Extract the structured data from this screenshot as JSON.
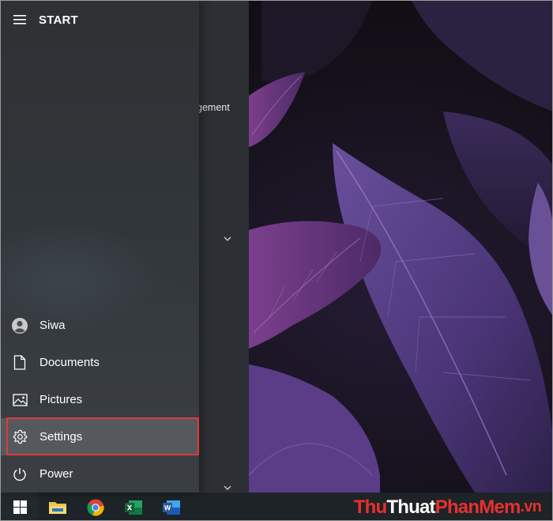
{
  "start_menu": {
    "title": "START",
    "apps_partial_label": "gement",
    "items": [
      {
        "label": "Siwa",
        "icon": "user-avatar-icon"
      },
      {
        "label": "Documents",
        "icon": "document-icon"
      },
      {
        "label": "Pictures",
        "icon": "pictures-icon"
      },
      {
        "label": "Settings",
        "icon": "gear-icon",
        "highlighted": true
      },
      {
        "label": "Power",
        "icon": "power-icon"
      }
    ]
  },
  "taskbar": {
    "apps": [
      "windows-start-icon",
      "file-explorer-icon",
      "chrome-icon",
      "excel-icon",
      "word-icon"
    ]
  },
  "watermark": {
    "part1": "Thu",
    "part2": "Thuat",
    "part3": "PhanMem",
    "part4": ".vn"
  },
  "colors": {
    "highlight_border": "#e0393e",
    "menu_bg": "#2f3236",
    "taskbar_bg": "#1d2326",
    "accent_red": "#e8302f"
  }
}
